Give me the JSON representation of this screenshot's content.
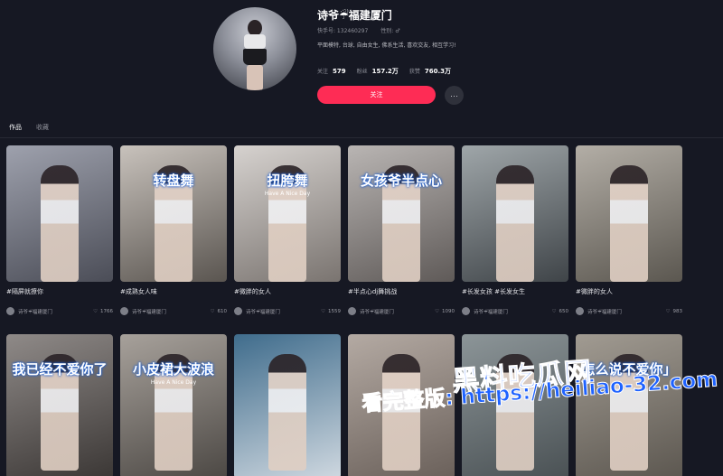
{
  "profile": {
    "name": "诗爷☔福建厦门",
    "id_label": "快手号: 132460297",
    "gender_label": "性别: ♂",
    "bio": "平面模特, 台球, 自由女生, 佛系生活, 喜欢交友, 相互学习!",
    "stats": [
      {
        "label": "关注",
        "value": "579"
      },
      {
        "label": "粉丝",
        "value": "157.2万"
      },
      {
        "label": "获赞",
        "value": "760.3万"
      }
    ],
    "follow_label": "关注",
    "more_label": "···"
  },
  "tabs": [
    {
      "label": "作品",
      "active": true
    },
    {
      "label": "收藏",
      "active": false
    }
  ],
  "cards": [
    {
      "title": "#隔屏就撩你",
      "author": "诗爷☔福建厦门",
      "likes": "1766",
      "overlay": "",
      "sub": "",
      "bg": [
        "#9ea1ad",
        "#4b4d57"
      ]
    },
    {
      "title": "#成熟女人味",
      "author": "诗爷☔福建厦门",
      "likes": "610",
      "overlay": "转盘舞",
      "sub": "",
      "bg": [
        "#c8c2bc",
        "#5a5550"
      ]
    },
    {
      "title": "#微胖的女人",
      "author": "诗爷☔福建厦门",
      "likes": "1559",
      "overlay": "扭胯舞",
      "sub": "Have A Nice Day",
      "bg": [
        "#d6d2cf",
        "#7a7470"
      ]
    },
    {
      "title": "#半点心dj舞挑战",
      "author": "诗爷☔福建厦门",
      "likes": "1090",
      "overlay": "女孩爷半点心",
      "sub": "",
      "bg": [
        "#b9b5b3",
        "#5f5a58"
      ]
    },
    {
      "title": "#长发女孩 #长发女生",
      "author": "诗爷☔福建厦门",
      "likes": "650",
      "overlay": "",
      "sub": "",
      "bg": [
        "#9fa6a9",
        "#3f4448"
      ]
    },
    {
      "title": "#微胖的女人",
      "author": "诗爷☔福建厦门",
      "likes": "983",
      "overlay": "",
      "sub": "",
      "bg": [
        "#b3aea6",
        "#5b5750"
      ]
    },
    {
      "title": "",
      "author": "",
      "likes": "",
      "overlay": "我已经不爱你了",
      "sub": "",
      "bg": [
        "#8f8a88",
        "#3b3735"
      ]
    },
    {
      "title": "",
      "author": "",
      "likes": "",
      "overlay": "小皮裙大波浪",
      "sub": "Have A Nice Day",
      "bg": [
        "#a7a19b",
        "#4c4844"
      ]
    },
    {
      "title": "",
      "author": "",
      "likes": "",
      "overlay": "",
      "sub": "",
      "bg": [
        "#3f6c8c",
        "#cfd8e0"
      ]
    },
    {
      "title": "",
      "author": "",
      "likes": "",
      "overlay": "",
      "sub": "",
      "bg": [
        "#b4aaa3",
        "#6a605a"
      ]
    },
    {
      "title": "",
      "author": "",
      "likes": "",
      "overlay": "",
      "sub": "",
      "bg": [
        "#8c9598",
        "#4a5154"
      ]
    },
    {
      "title": "",
      "author": "",
      "likes": "",
      "overlay": "怎么说不爱你」",
      "sub": "",
      "bg": [
        "#a19b92",
        "#5c5750"
      ]
    }
  ],
  "watermark": {
    "logo": "黑料吃瓜网",
    "url": "看完整版: https://heiliao-32.com"
  }
}
